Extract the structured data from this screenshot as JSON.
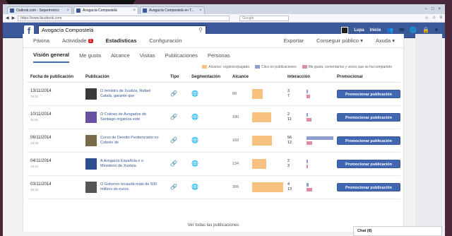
{
  "browser": {
    "tabs": [
      {
        "label": "Outlook.com - Sepertronics",
        "active": false
      },
      {
        "label": "Avogacía Compostelá",
        "active": true
      },
      {
        "label": "Avogacía Compostelá en T...",
        "active": false
      }
    ],
    "url": "https://www.facebook.com",
    "search_placeholder": "Google"
  },
  "fb": {
    "logo": "f",
    "search_value": "Avogacía Compostelá",
    "user_name": "Lupa",
    "home_label": "Inicio"
  },
  "topnav": {
    "items": [
      {
        "label": "Páxina",
        "badge": ""
      },
      {
        "label": "Actividade",
        "badge": "1"
      },
      {
        "label": "Estadísticas",
        "badge": ""
      },
      {
        "label": "Configuración",
        "badge": ""
      }
    ],
    "right": [
      "Exportar",
      "Conseguir público ▾",
      "Axuda ▾"
    ]
  },
  "subtabs": [
    "Visión general",
    "Me gusta",
    "Alcance",
    "Visitas",
    "Publicaciones",
    "Personas"
  ],
  "legend": [
    {
      "label": "Alcance: orgánico/pagado",
      "color": "#f7c27f"
    },
    {
      "label": "Clics en publicaciones",
      "color": "#8c9ed0"
    },
    {
      "label": "Me gusta, comentarios y veces que se ha compartido",
      "color": "#e08aa6"
    }
  ],
  "table": {
    "headers": [
      "Fecha de publicación",
      "Publicación",
      "Tipo",
      "Segmentación",
      "Alcance",
      "Interacción",
      "Promocionar"
    ],
    "rows": [
      {
        "date": "13/11/2014",
        "time": "15:41",
        "text": "O ministro de Xustiza, Rafael Catalá, garante que",
        "reach": "88",
        "reach_pct": 0.35,
        "int_a": "3",
        "int_b": "7",
        "clicks_pct": 0.05,
        "likes_pct": 0.12,
        "promo": "Promocionar publicación"
      },
      {
        "date": "10/11/2014",
        "time": "11:40",
        "text": "O Colexio de Avogados de Santiago organiza este",
        "reach": "180",
        "reach_pct": 0.62,
        "int_a": "2",
        "int_b": "11",
        "clicks_pct": 0.04,
        "likes_pct": 0.18,
        "promo": "Promocionar publicación"
      },
      {
        "date": "06/11/2014",
        "time": "13:33",
        "text": "Curso de Dereito Penitenciario no Colexio de",
        "reach": "183",
        "reach_pct": 0.63,
        "int_a": "56",
        "int_b": "12",
        "clicks_pct": 1.0,
        "likes_pct": 0.2,
        "promo": "Promocionar publicación"
      },
      {
        "date": "04/11/2014",
        "time": "13:44",
        "text": "A Avogacía Española e o Ministerio de Xustiza",
        "reach": "134",
        "reach_pct": 0.46,
        "int_a": "2",
        "int_b": "3",
        "clicks_pct": 0.04,
        "likes_pct": 0.05,
        "promo": "Promocionar publicación"
      },
      {
        "date": "03/11/2014",
        "time": "10:10",
        "text": "O Goberno recaudá máis de 500 millóns de euros",
        "reach": "306",
        "reach_pct": 1.0,
        "int_a": "4",
        "int_b": "13",
        "clicks_pct": 0.07,
        "likes_pct": 0.21,
        "promo": "Promocionar publicación"
      }
    ],
    "view_all": "Ver todas las publicaciones"
  },
  "chat_label": "Chat (8)"
}
